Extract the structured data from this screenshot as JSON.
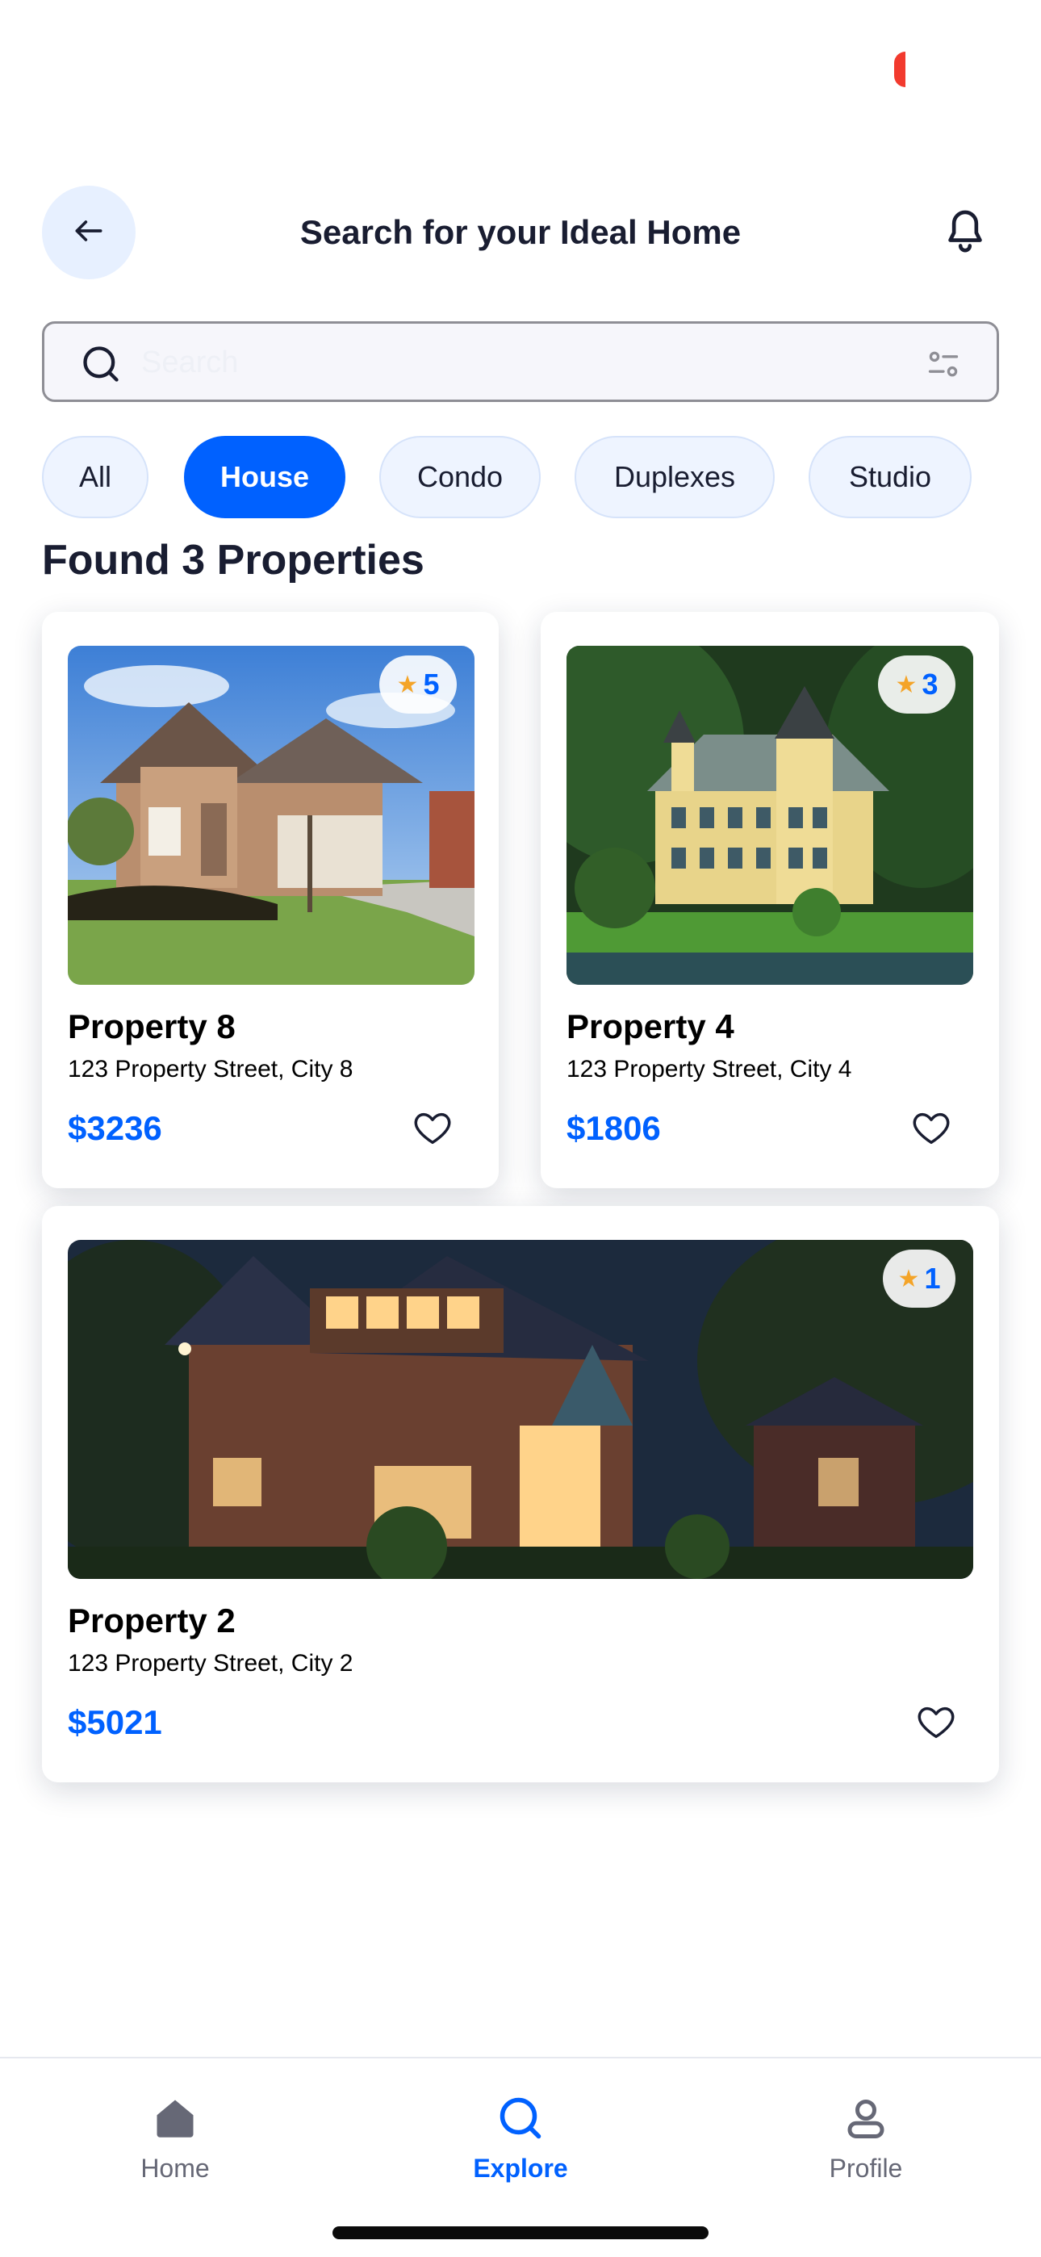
{
  "header": {
    "title": "Search for your Ideal Home",
    "back_icon": "arrow-left-icon",
    "bell_icon": "bell-icon"
  },
  "search": {
    "placeholder": "Search",
    "value": "",
    "icon": "search-icon",
    "filter_icon": "filter-icon"
  },
  "categories": {
    "selected": "House",
    "items": [
      "All",
      "House",
      "Condo",
      "Duplexes",
      "Studio"
    ]
  },
  "results": {
    "title": "Found 3 Properties"
  },
  "properties": [
    {
      "name": "Property 8",
      "address": "123 Property Street, City 8",
      "price": "$3236",
      "rating": "5"
    },
    {
      "name": "Property 4",
      "address": "123 Property Street, City 4",
      "price": "$1806",
      "rating": "3"
    },
    {
      "name": "Property 2",
      "address": "123 Property Street, City 2",
      "price": "$5021",
      "rating": "1"
    }
  ],
  "nav": {
    "items": [
      {
        "label": "Home",
        "icon": "home-icon"
      },
      {
        "label": "Explore",
        "icon": "search-icon"
      },
      {
        "label": "Profile",
        "icon": "profile-icon"
      }
    ],
    "active": "Explore"
  },
  "colors": {
    "accent": "#0061ff",
    "chip_bg": "#eef4ff",
    "star": "#f4a428",
    "text": "#191d31"
  }
}
